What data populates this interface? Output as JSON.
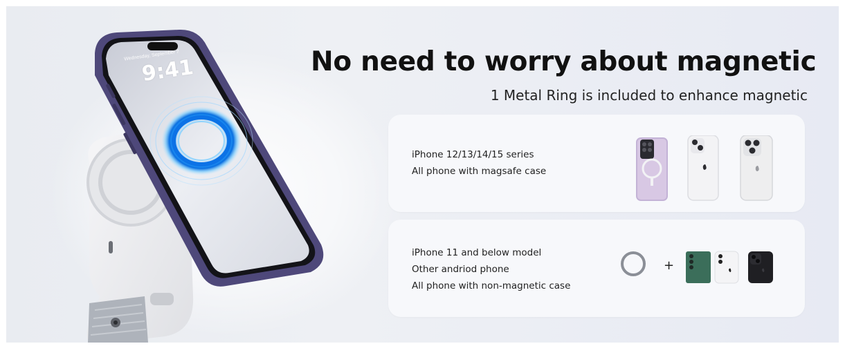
{
  "banner": {
    "headline": "No need to worry about magnetic",
    "subline": "1 Metal Ring is included to enhance magnetic"
  },
  "phone_screen": {
    "date": "Wednesday, September 7",
    "time": "9:41"
  },
  "card_magnetic": {
    "lines": [
      "iPhone 12/13/14/15 series",
      "All phone with magsafe case"
    ]
  },
  "card_non_magnetic": {
    "lines": [
      "iPhone 11 and below model",
      "Other andriod phone",
      "All phone with non-magnetic case"
    ],
    "plus": "+"
  },
  "colors": {
    "accent_ring": "#1e9bff",
    "phone_frame": "#5a5488",
    "card_bg": "#f7f8fb"
  }
}
